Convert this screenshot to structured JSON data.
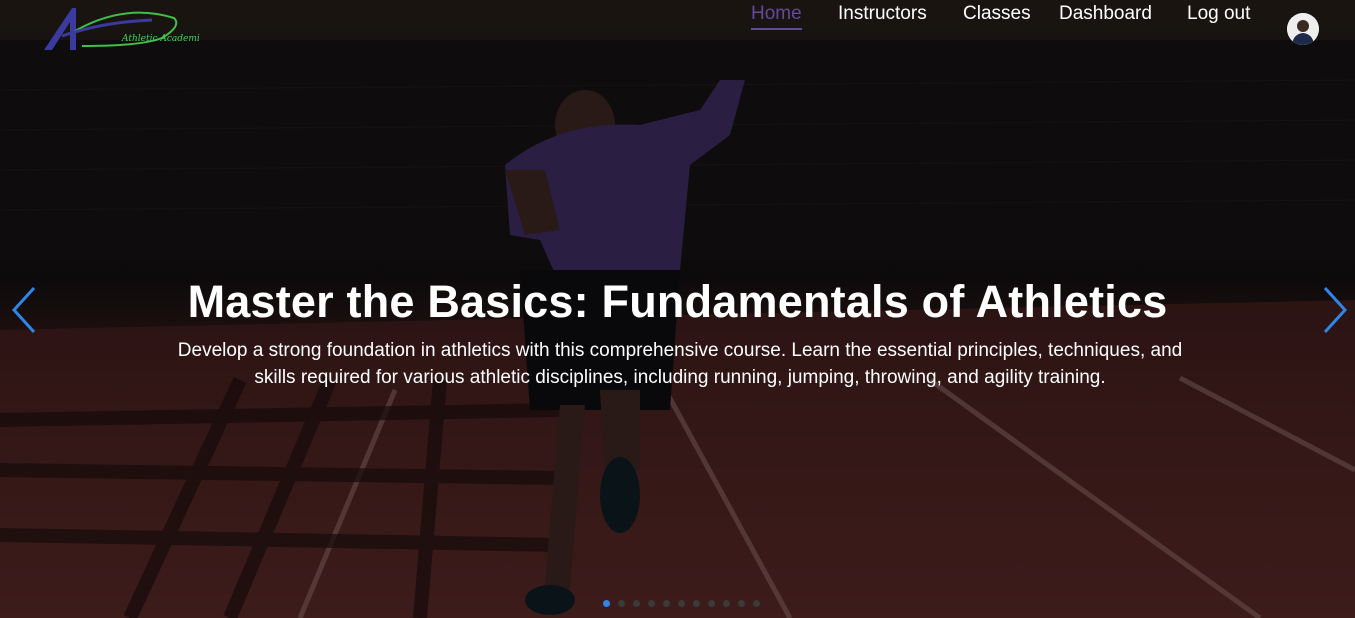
{
  "brand": {
    "logo_text": "Athletic Academi",
    "logo_colors": {
      "mark": "#3b3aa0",
      "swoosh": "#3fbf49"
    }
  },
  "nav": {
    "items": [
      {
        "label": "Home",
        "active": true
      },
      {
        "label": "Instructors",
        "active": false
      },
      {
        "label": "Classes",
        "active": false
      },
      {
        "label": "Dashboard",
        "active": false
      },
      {
        "label": "Log out",
        "active": false
      }
    ],
    "active_color": "#5f4b9a"
  },
  "hero": {
    "title": "Master the Basics: Fundamentals of Athletics",
    "description": "Develop a strong foundation in athletics with this comprehensive course. Learn the essential principles, techniques, and skills required for various athletic disciplines, including running, jumping, throwing, and agility training.",
    "prev_icon": "chevron-left-icon",
    "next_icon": "chevron-right-icon",
    "arrow_color": "#2f86e8"
  },
  "carousel": {
    "slide_count": 11,
    "active_index": 0,
    "active_color": "#2f86e8"
  },
  "user": {
    "avatar_icon": "user-avatar-icon"
  }
}
